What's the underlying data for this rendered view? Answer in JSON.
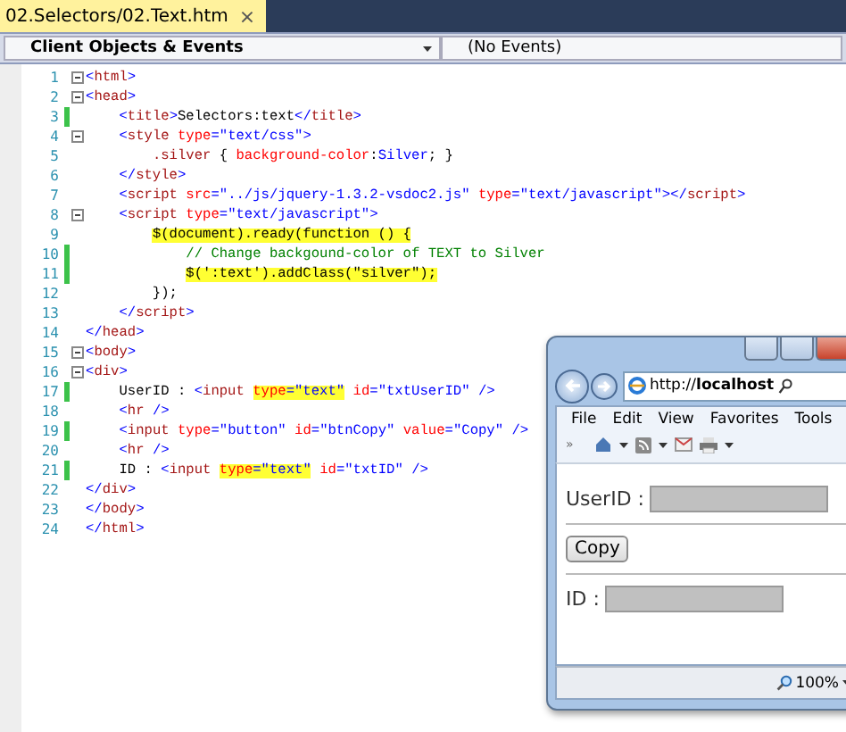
{
  "tab": {
    "title": "02.Selectors/02.Text.htm",
    "close": "×"
  },
  "navigation_bar": {
    "objects": "Client Objects & Events",
    "events": "(No Events)"
  },
  "code_lines": [
    {
      "number": "1",
      "changed": false,
      "fold": true,
      "segments": [
        {
          "text": "<html>",
          "highlighted": false
        }
      ]
    },
    {
      "number": "2",
      "changed": false,
      "fold": true,
      "segments": [
        {
          "text": "<head>",
          "highlighted": false
        }
      ]
    },
    {
      "number": "3",
      "changed": true,
      "fold": false,
      "segments": [
        {
          "text": "    <title>Selectors:text</title>",
          "highlighted": false
        }
      ]
    },
    {
      "number": "4",
      "changed": false,
      "fold": true,
      "segments": [
        {
          "text": "    <style type=\"text/css\">",
          "highlighted": false
        }
      ]
    },
    {
      "number": "5",
      "changed": false,
      "fold": false,
      "segments": [
        {
          "text": "        .silver { background-color:Silver; }",
          "highlighted": false
        }
      ]
    },
    {
      "number": "6",
      "changed": false,
      "fold": false,
      "segments": [
        {
          "text": "    </style>",
          "highlighted": false
        }
      ]
    },
    {
      "number": "7",
      "changed": false,
      "fold": false,
      "segments": [
        {
          "text": "    <script src=\"../js/jquery-1.3.2-vsdoc2.js\" type=\"text/javascript\"></script>",
          "highlighted": false
        }
      ]
    },
    {
      "number": "8",
      "changed": false,
      "fold": true,
      "segments": [
        {
          "text": "    <script type=\"text/javascript\">",
          "highlighted": false
        }
      ]
    },
    {
      "number": "9",
      "changed": false,
      "fold": false,
      "segments": [
        {
          "text": "        $(document).ready(function () {",
          "highlighted": true
        }
      ]
    },
    {
      "number": "10",
      "changed": true,
      "fold": false,
      "segments": [
        {
          "text": "            // Change backgound-color of TEXT to Silver",
          "highlighted": false
        }
      ]
    },
    {
      "number": "11",
      "changed": true,
      "fold": false,
      "segments": [
        {
          "text": "            $(':text').addClass(\"silver\");",
          "highlighted": true
        }
      ]
    },
    {
      "number": "12",
      "changed": false,
      "fold": false,
      "segments": [
        {
          "text": "        });",
          "highlighted": false
        }
      ]
    },
    {
      "number": "13",
      "changed": false,
      "fold": false,
      "segments": [
        {
          "text": "    </script>",
          "highlighted": false
        }
      ]
    },
    {
      "number": "14",
      "changed": false,
      "fold": false,
      "segments": [
        {
          "text": "</head>",
          "highlighted": false
        }
      ]
    },
    {
      "number": "15",
      "changed": false,
      "fold": true,
      "segments": [
        {
          "text": "<body>",
          "highlighted": false
        }
      ]
    },
    {
      "number": "16",
      "changed": false,
      "fold": true,
      "segments": [
        {
          "text": "<div>",
          "highlighted": false
        }
      ]
    },
    {
      "number": "17",
      "changed": true,
      "fold": false,
      "segments": [
        {
          "text": "    UserID : <input ",
          "highlighted": false
        },
        {
          "text": "type=\"text\"",
          "highlighted": true
        },
        {
          "text": " id=\"txtUserID\" />",
          "highlighted": false
        }
      ]
    },
    {
      "number": "18",
      "changed": false,
      "fold": false,
      "segments": [
        {
          "text": "    <hr />",
          "highlighted": false
        }
      ]
    },
    {
      "number": "19",
      "changed": true,
      "fold": false,
      "segments": [
        {
          "text": "    <input type=\"button\" id=\"btnCopy\" value=\"Copy\" />",
          "highlighted": false
        }
      ]
    },
    {
      "number": "20",
      "changed": false,
      "fold": false,
      "segments": [
        {
          "text": "    <hr />",
          "highlighted": false
        }
      ]
    },
    {
      "number": "21",
      "changed": true,
      "fold": false,
      "segments": [
        {
          "text": "    ID : <input ",
          "highlighted": false
        },
        {
          "text": "type=\"text\"",
          "highlighted": true
        },
        {
          "text": " id=\"txtID\" />",
          "highlighted": false
        }
      ]
    },
    {
      "number": "22",
      "changed": false,
      "fold": false,
      "segments": [
        {
          "text": "</div>",
          "highlighted": false
        }
      ]
    },
    {
      "number": "23",
      "changed": false,
      "fold": false,
      "segments": [
        {
          "text": "</body>",
          "highlighted": false
        }
      ]
    },
    {
      "number": "24",
      "changed": false,
      "fold": false,
      "segments": [
        {
          "text": "</html>",
          "highlighted": false
        }
      ]
    }
  ],
  "browser": {
    "address": {
      "scheme": "http://",
      "host": "localhost"
    },
    "menu": [
      "File",
      "Edit",
      "View",
      "Favorites",
      "Tools"
    ],
    "more": "»",
    "page": {
      "user_label": "UserID :",
      "button": "Copy",
      "id_label": "ID :"
    },
    "zoom": "100%"
  }
}
